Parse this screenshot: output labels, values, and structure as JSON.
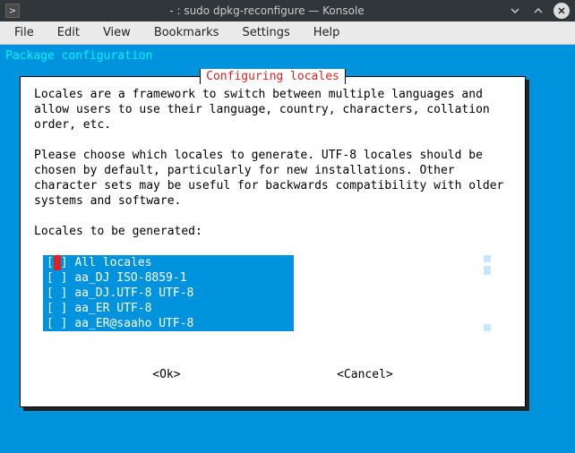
{
  "titlebar": {
    "title": "- : sudo dpkg-reconfigure — Konsole"
  },
  "menubar": {
    "items": [
      "File",
      "Edit",
      "View",
      "Bookmarks",
      "Settings",
      "Help"
    ]
  },
  "terminal": {
    "header": "Package configuration"
  },
  "dialog": {
    "title": "Configuring locales",
    "text": "Locales are a framework to switch between multiple languages and\nallow users to use their language, country, characters, collation\norder, etc.\n\nPlease choose which locales to generate. UTF-8 locales should be\nchosen by default, particularly for new installations. Other\ncharacter sets may be useful for backwards compatibility with older\nsystems and software.\n\nLocales to be generated:",
    "list": [
      {
        "checked": false,
        "focused": true,
        "label": "All locales"
      },
      {
        "checked": false,
        "focused": false,
        "label": "aa_DJ ISO-8859-1"
      },
      {
        "checked": false,
        "focused": false,
        "label": "aa_DJ.UTF-8 UTF-8"
      },
      {
        "checked": false,
        "focused": false,
        "label": "aa_ER UTF-8"
      },
      {
        "checked": false,
        "focused": false,
        "label": "aa_ER@saaho UTF-8"
      }
    ],
    "buttons": {
      "ok": "<Ok>",
      "cancel": "<Cancel>"
    }
  }
}
